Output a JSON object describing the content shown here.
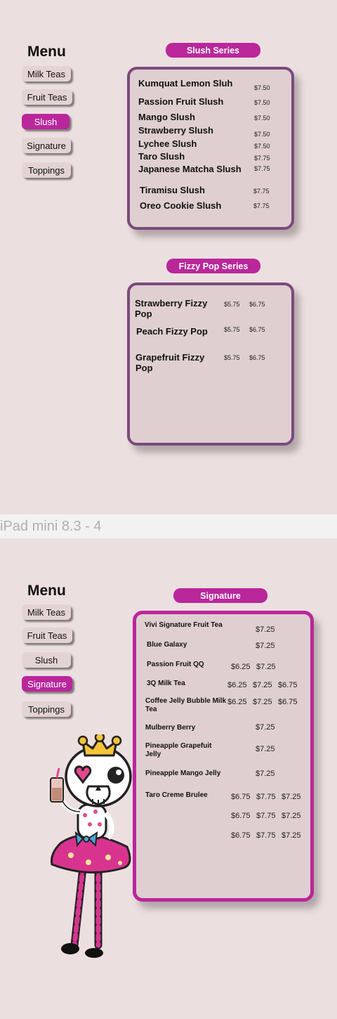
{
  "frame1": {
    "menu_title": "Menu",
    "nav": [
      {
        "label": "Milk Teas",
        "active": false
      },
      {
        "label": "Fruit Teas",
        "active": false
      },
      {
        "label": "Slush",
        "active": true
      },
      {
        "label": "Signature",
        "active": false
      },
      {
        "label": "Toppings",
        "active": false
      }
    ],
    "slush": {
      "title": "Slush Series",
      "items": [
        {
          "name": "Kumquat Lemon Sluh",
          "price": "$7.50"
        },
        {
          "name": "Passion Fruit Slush",
          "price": "$7.50"
        },
        {
          "name": "Mango Slush",
          "price": "$7.50"
        },
        {
          "name": "Strawberry Slush",
          "price": "$7.50"
        },
        {
          "name": "Lychee Slush",
          "price": "$7.50"
        },
        {
          "name": "Taro Slush",
          "price": "$7.75"
        },
        {
          "name": "Japanese Matcha Slush",
          "price": "$7.75"
        },
        {
          "name": "Tiramisu Slush",
          "price": "$7.75"
        },
        {
          "name": "Oreo Cookie Slush",
          "price": "$7.75"
        }
      ]
    },
    "fizzy": {
      "title": "Fizzy Pop Series",
      "items": [
        {
          "name": "Strawberry Fizzy Pop",
          "price1": "$5.75",
          "price2": "$6.75"
        },
        {
          "name": "Peach Fizzy Pop",
          "price1": "$5.75",
          "price2": "$6.75"
        },
        {
          "name": "Grapefruit Fizzy Pop",
          "price1": "$5.75",
          "price2": "$6.75"
        }
      ]
    }
  },
  "divider_label": "iPad mini 8.3 - 4",
  "frame2": {
    "menu_title": "Menu",
    "nav": [
      {
        "label": "Milk Teas",
        "active": false
      },
      {
        "label": "Fruit Teas",
        "active": false
      },
      {
        "label": "Slush",
        "active": false
      },
      {
        "label": "Signature",
        "active": true
      },
      {
        "label": "Toppings",
        "active": false
      }
    ],
    "signature": {
      "title": "Signature",
      "items": [
        {
          "name": "Vivi Signature Fruit Tea",
          "p1": "",
          "p2": "$7.25",
          "p3": ""
        },
        {
          "name": "Blue Galaxy",
          "p1": "",
          "p2": "$7.25",
          "p3": ""
        },
        {
          "name": "Passion Fruit QQ",
          "p1": "$6.25",
          "p2": "$7.25",
          "p3": ""
        },
        {
          "name": "3Q Milk Tea",
          "p1": "$6.25",
          "p2": "$7.25",
          "p3": "$6.75"
        },
        {
          "name": "Coffee Jelly Bubble Milk Tea",
          "p1": "$6.25",
          "p2": "$7.25",
          "p3": "$6.75"
        },
        {
          "name": "Mulberry Berry",
          "p1": "",
          "p2": "$7.25",
          "p3": ""
        },
        {
          "name": "Pineapple Grapefuit Jelly",
          "p1": "",
          "p2": "$7.25",
          "p3": ""
        },
        {
          "name": "Pineapple Mango Jelly",
          "p1": "",
          "p2": "$7.25",
          "p3": ""
        },
        {
          "name": "Taro Creme Brulee",
          "p1": "$6.75",
          "p2": "$7.75",
          "p3": "$7.25"
        },
        {
          "name": "",
          "p1": "$6.75",
          "p2": "$7.75",
          "p3": "$7.25"
        },
        {
          "name": "",
          "p1": "$6.75",
          "p2": "$7.75",
          "p3": "$7.25"
        }
      ]
    }
  },
  "colors": {
    "background": "#ecdfe0",
    "accent": "#b9279b",
    "card_border_purple": "#7b4a7a",
    "card_fill": "#dfcfd1"
  },
  "icons": [
    "mascot-skull-girl-illustration"
  ]
}
